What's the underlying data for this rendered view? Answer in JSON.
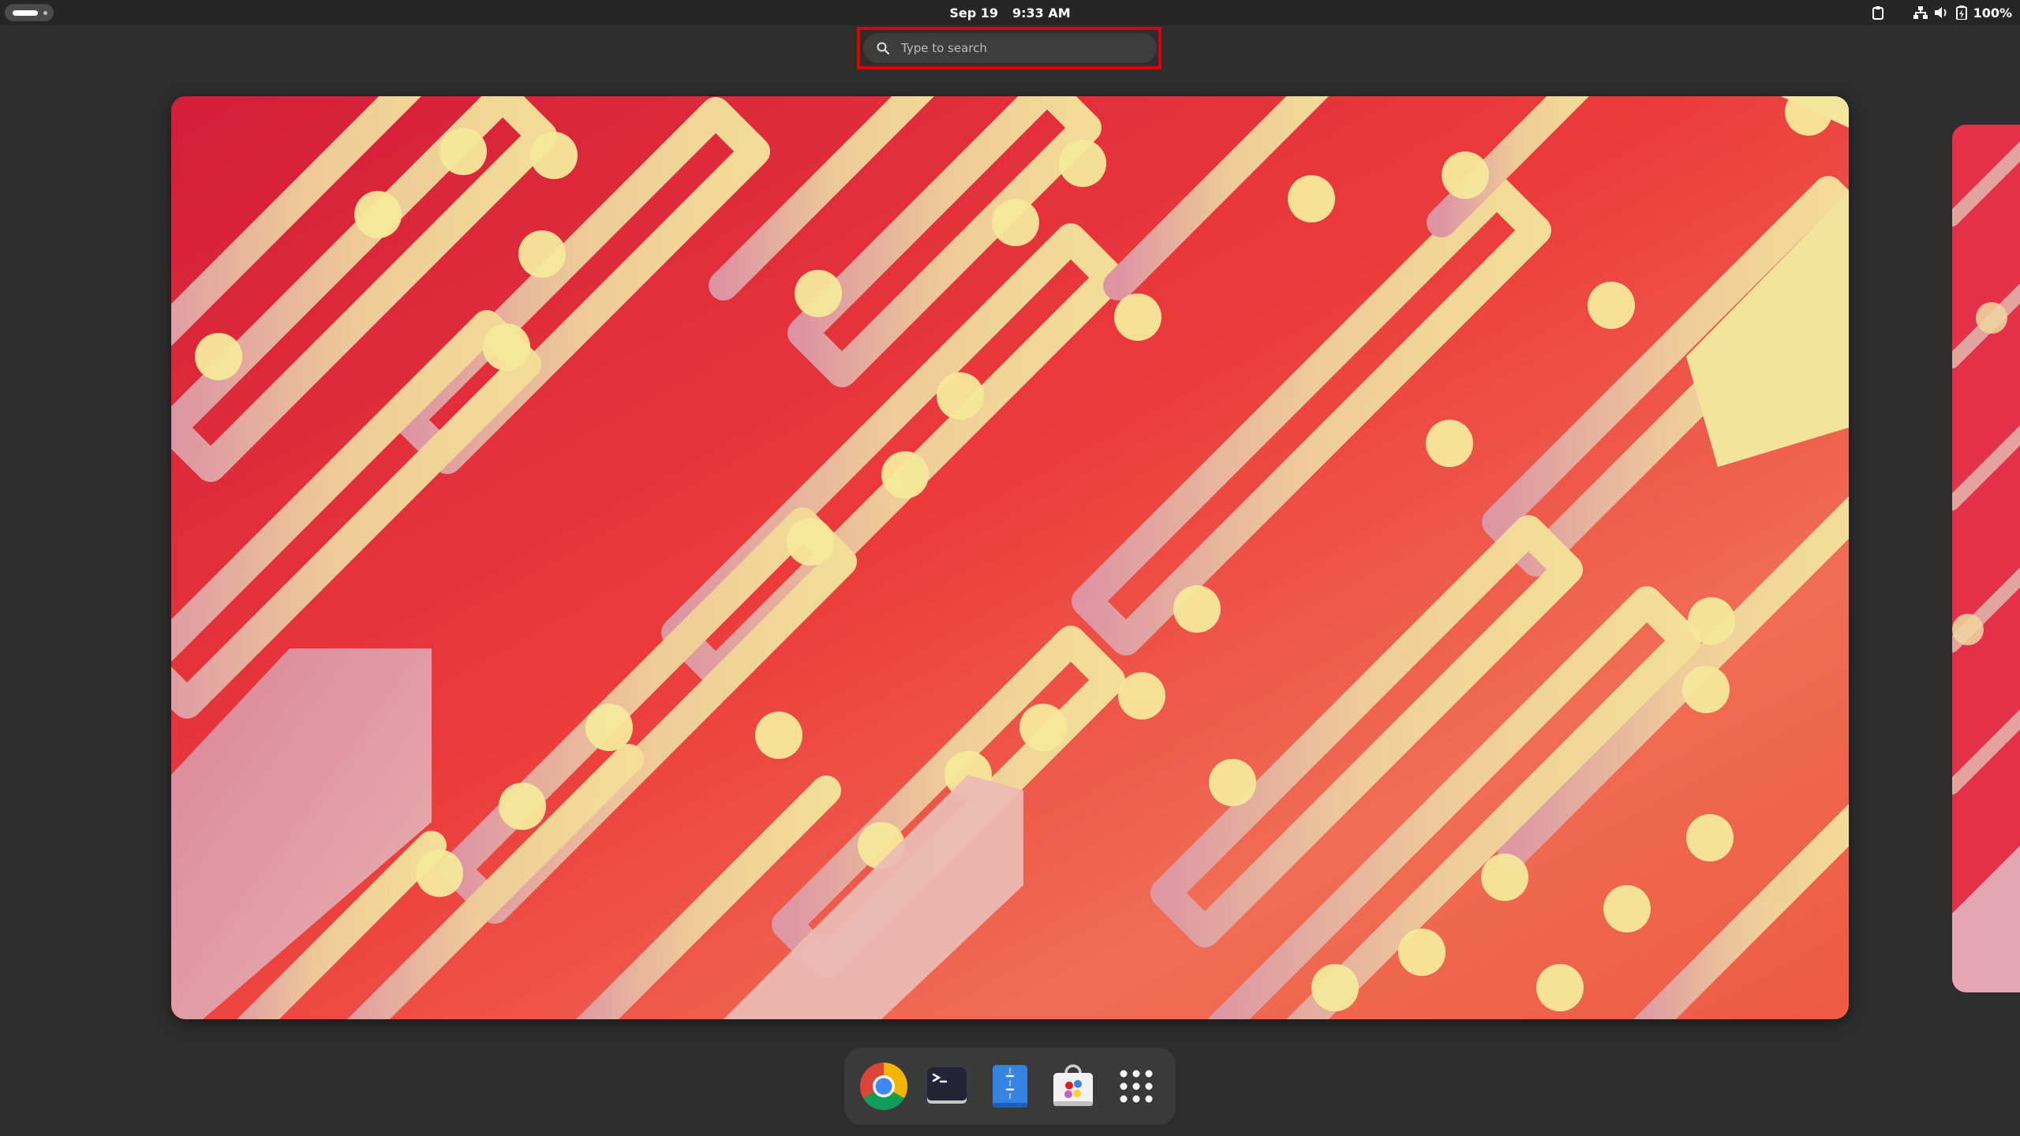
{
  "topbar": {
    "date": "Sep 19",
    "time": "9:33 AM",
    "battery_percent": "100%"
  },
  "search": {
    "placeholder": "Type to search"
  },
  "dock": {
    "apps": [
      {
        "name": "Google Chrome",
        "icon": "chrome-icon"
      },
      {
        "name": "Terminal",
        "icon": "terminal-icon"
      },
      {
        "name": "Text Editor",
        "icon": "text-editor-icon"
      },
      {
        "name": "Software",
        "icon": "software-store-icon"
      },
      {
        "name": "Show Apps",
        "icon": "app-grid-icon"
      }
    ]
  },
  "colors": {
    "panel": "#262626",
    "overview_bg": "#2d2d2d",
    "search_highlight": "#e00000",
    "wallpaper_red": "#e23246",
    "wallpaper_cream": "#f1e6a0"
  }
}
